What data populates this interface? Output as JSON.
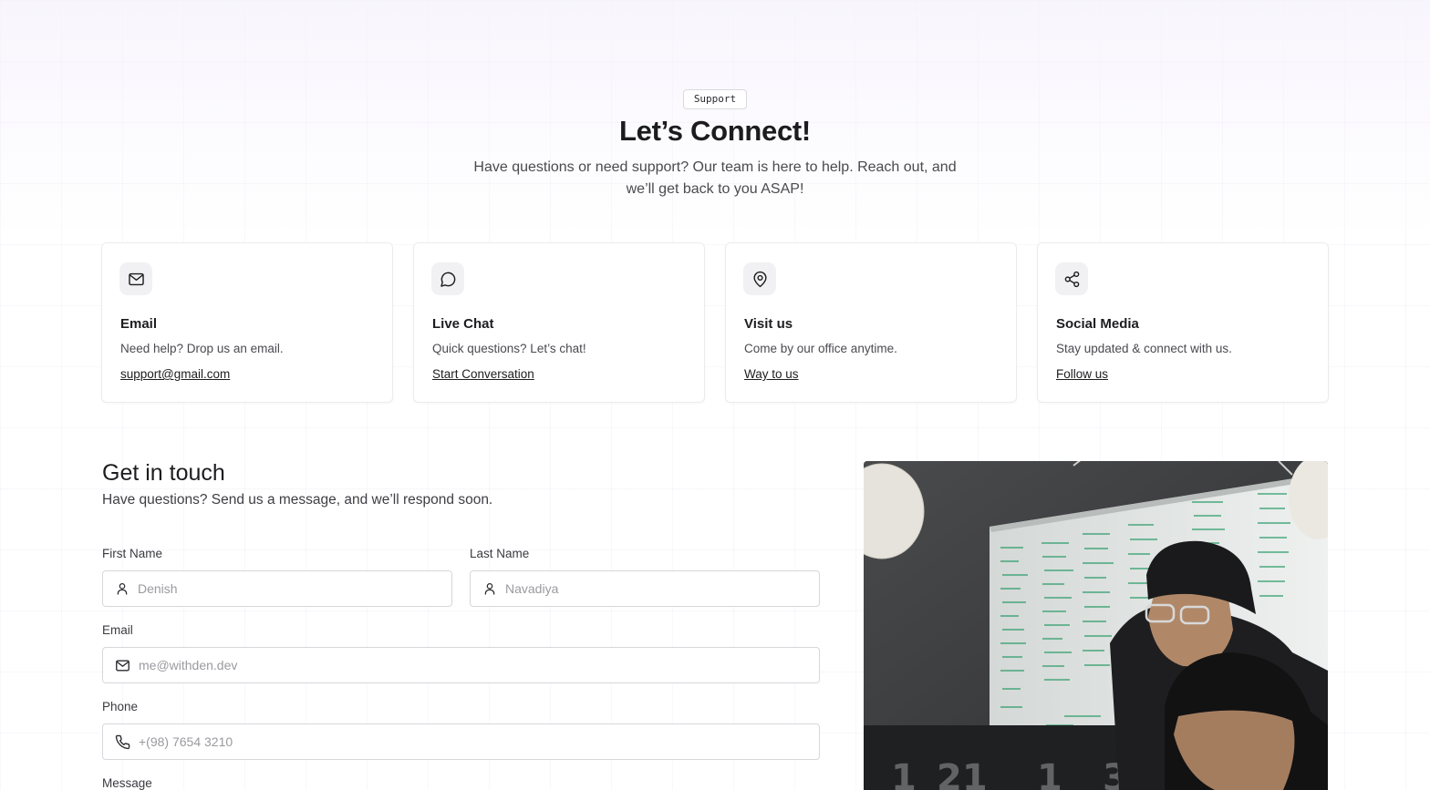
{
  "hero": {
    "badge": "Support",
    "title": "Let’s Connect!",
    "subtitle_line1": "Have questions or need support? Our team is here to help. Reach out, and",
    "subtitle_line2": "we’ll get back to you ASAP!"
  },
  "cards": [
    {
      "icon": "mail-icon",
      "title": "Email",
      "description": "Need help? Drop us an email.",
      "link": "support@gmail.com"
    },
    {
      "icon": "chat-bubble-icon",
      "title": "Live Chat",
      "description": "Quick questions? Let’s chat!",
      "link": "Start Conversation"
    },
    {
      "icon": "map-pin-icon",
      "title": "Visit us",
      "description": "Come by our office anytime.",
      "link": "Way to us"
    },
    {
      "icon": "share-icon",
      "title": "Social Media",
      "description": "Stay updated & connect with us.",
      "link": "Follow us"
    }
  ],
  "contact": {
    "title": "Get in touch",
    "subtitle": "Have questions? Send us a message, and we’ll respond soon.",
    "first_name": {
      "label": "First Name",
      "placeholder": "Denish",
      "icon": "user-icon"
    },
    "last_name": {
      "label": "Last Name",
      "placeholder": "Navadiya",
      "icon": "user-icon"
    },
    "email": {
      "label": "Email",
      "placeholder": "me@withden.dev",
      "icon": "mail-icon"
    },
    "phone": {
      "label": "Phone",
      "placeholder": "+(98) 7654 3210",
      "icon": "phone-icon"
    },
    "message": {
      "label": "Message"
    }
  },
  "photo": {
    "board_numbers": [
      "1",
      "21",
      "1",
      "3"
    ]
  }
}
